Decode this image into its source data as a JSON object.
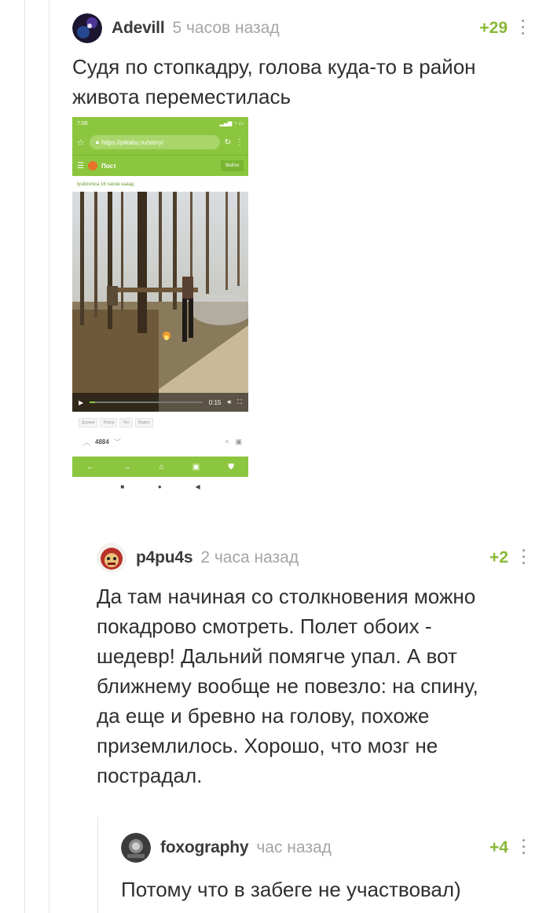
{
  "comments": [
    {
      "author": "Adevill",
      "time": "5 часов назад",
      "rating": "+29",
      "text_lines": [
        "Судя по стопкадру, голова куда-то в район",
        "живота переместилась"
      ]
    },
    {
      "author": "p4pu4s",
      "time": "2 часа назад",
      "rating": "+2",
      "text_lines": [
        "Да там начиная со столкновения можно",
        "покадрово смотреть. Полет обоих -",
        "шедевр! Дальний помягче упал. А вот",
        "ближнему вообще не повезло: на спину,",
        "да еще и бревно на голову, похоже",
        "приземлилось. Хорошо, что мозг не",
        "пострадал."
      ]
    },
    {
      "author": "foxography",
      "time": "час назад",
      "rating": "+4",
      "text_lines": [
        "Потому что в забеге не участвовал)"
      ]
    }
  ],
  "screenshot": {
    "status_time": "7:06",
    "url": "https://pikabu.ru/story/",
    "nav_title": "Пост",
    "login_label": "Войти",
    "meta": "lyubovnica 16 часов назад",
    "video_time": "0:15",
    "video_progress": 0.05,
    "tags": [
      "Дураки",
      "Юмор",
      "Лес",
      "Видео"
    ],
    "vote_count": "4884"
  },
  "colors": {
    "accent_green": "#8cc63f",
    "rating_green": "#8ab837",
    "meta_gray": "#a5a5a5"
  },
  "icons": [
    "star-icon",
    "lock-icon",
    "reload-icon",
    "menu-icon",
    "play-icon",
    "volume-icon",
    "fullscreen-icon",
    "share-icon",
    "save-icon",
    "back-icon",
    "forward-icon",
    "home-icon",
    "tabs-icon",
    "shield-icon"
  ]
}
